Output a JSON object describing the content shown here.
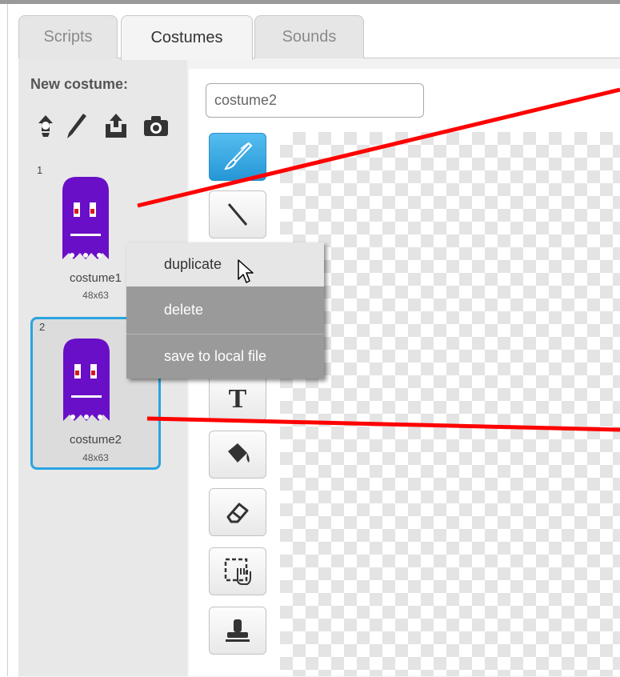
{
  "tabs": [
    {
      "label": "Scripts"
    },
    {
      "label": "Costumes"
    },
    {
      "label": "Sounds"
    }
  ],
  "new_costume": {
    "label": "New costume:",
    "icons": [
      "choose-from-library-icon",
      "paint-new-icon",
      "upload-icon",
      "camera-icon"
    ]
  },
  "costumes": [
    {
      "number": "1",
      "name": "costume1",
      "size": "48x63"
    },
    {
      "number": "2",
      "name": "costume2",
      "size": "48x63"
    }
  ],
  "editor": {
    "costume_name_value": "costume2"
  },
  "tools": [
    "brush-icon",
    "line-icon",
    "text-icon",
    "fill-icon",
    "eraser-icon",
    "select-icon",
    "stamp-icon"
  ],
  "context_menu": {
    "items": [
      {
        "label": "duplicate"
      },
      {
        "label": "delete"
      },
      {
        "label": "save to local file"
      }
    ]
  },
  "colors": {
    "selection_border": "#2aa4e0",
    "ghost": "#6a0fc8",
    "annotation": "#ff0000"
  }
}
